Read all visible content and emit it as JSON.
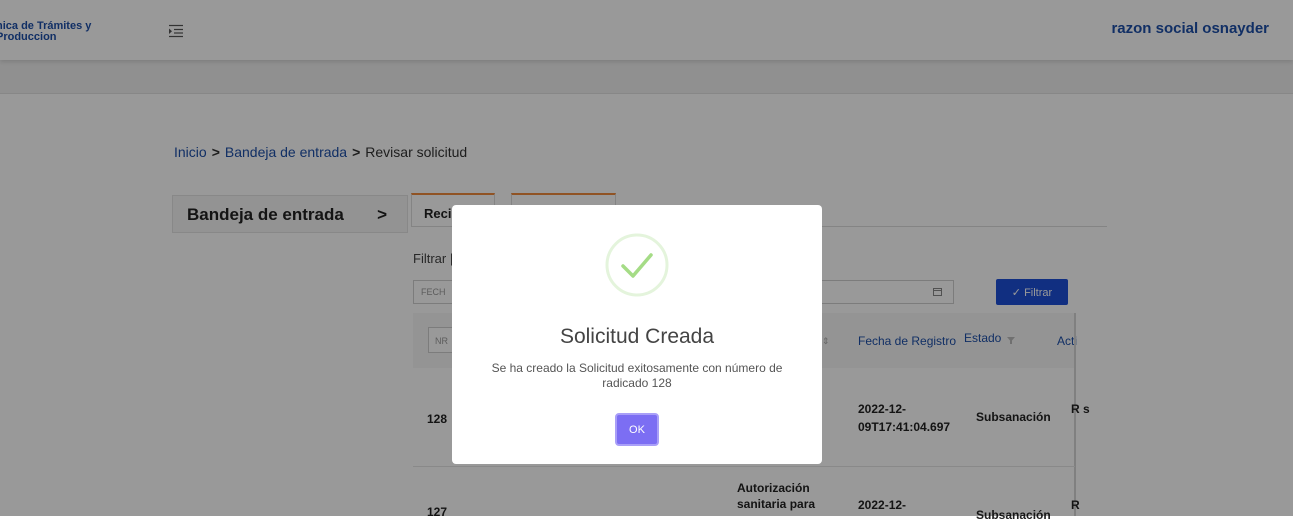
{
  "header": {
    "brand_line1": "nica de Trámites y",
    "brand_line2": "Produccion",
    "menu_icon": "menu-indent-icon",
    "user_name": "razon social osnayder"
  },
  "breadcrumb": {
    "items": [
      "Inicio",
      "Bandeja de entrada",
      "Revisar solicitud"
    ],
    "separator": ">"
  },
  "sidebar": {
    "label": "Bandeja de entrada",
    "chevron": ">"
  },
  "tabs": [
    {
      "label": "Reci"
    },
    {
      "label": ""
    }
  ],
  "filter": {
    "label": "Filtrar",
    "label_visible": "Filtrar |",
    "date_placeholder": "FECH",
    "button_label": "✓ Filtrar"
  },
  "table": {
    "search_placeholder": "NR",
    "headers": {
      "fecha": "Fecha de Registro",
      "estado": "Estado",
      "acciones": "Acti"
    },
    "rows": [
      {
        "nro": "128",
        "fecha": "2022-12-09T17:41:04.697",
        "estado": "Subsanación",
        "acciones": "R s"
      },
      {
        "nro": "127",
        "tramite": "Autorización sanitaria para",
        "fecha": "2022-12-",
        "estado": "Subsanación",
        "acciones": "R"
      }
    ]
  },
  "modal": {
    "title": "Solicitud Creada",
    "message": "Se ha creado la Solicitud exitosamente con número de radicado 128",
    "ok_label": "OK",
    "icon": "success-check-icon",
    "accent_color": "#7c6ef3",
    "success_color": "#a5dc86"
  }
}
